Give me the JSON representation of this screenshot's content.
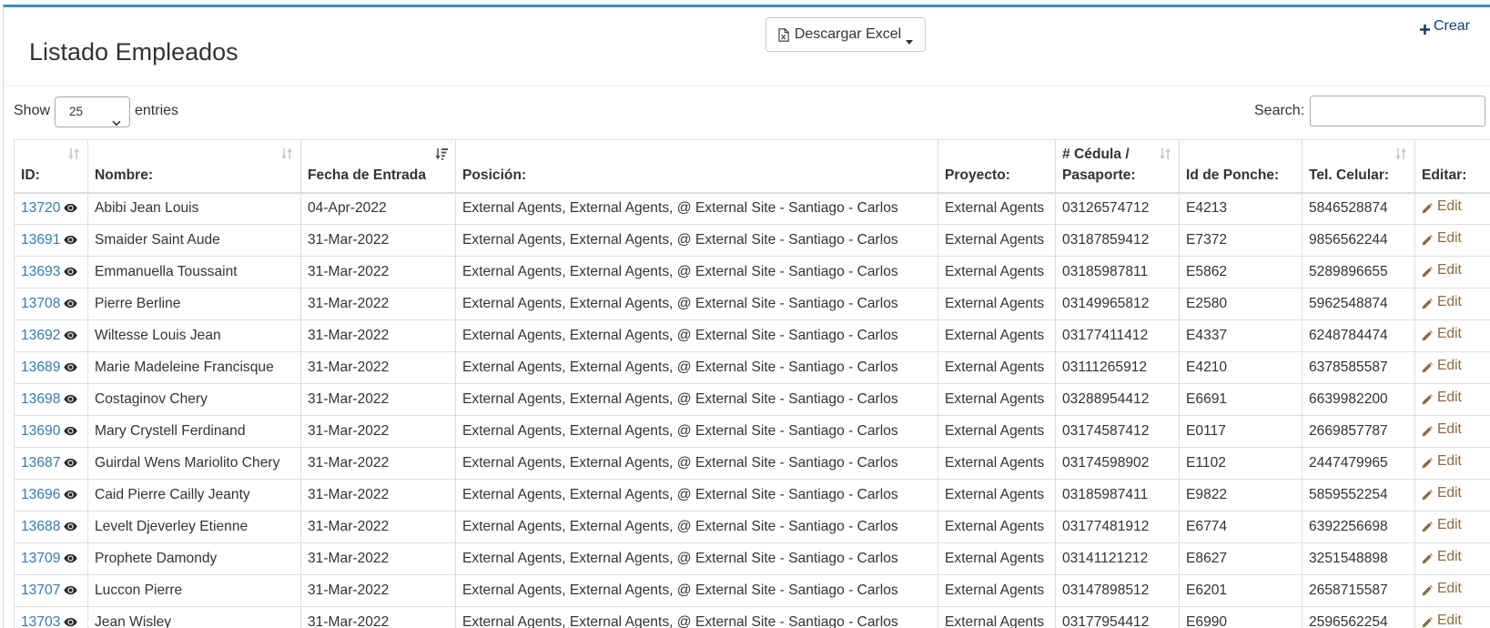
{
  "app": {
    "title": "Listado Empleados"
  },
  "toolbar": {
    "excel_label": "Descargar Excel",
    "create_label": "Crear"
  },
  "controls": {
    "show_label": "Show",
    "entries_value": "25",
    "entries_label": "entries",
    "search_label": "Search:",
    "search_value": ""
  },
  "table": {
    "columns": [
      {
        "label": "ID:",
        "sort": "both"
      },
      {
        "label": "Nombre:",
        "sort": "both"
      },
      {
        "label": "Fecha de Entrada",
        "sort": "desc"
      },
      {
        "label": "Posición:",
        "sort": "none"
      },
      {
        "label": "Proyecto:",
        "sort": "none"
      },
      {
        "label": "# Cédula / Pasaporte:",
        "sort": "both"
      },
      {
        "label": "Id de Ponche:",
        "sort": "none"
      },
      {
        "label": "Tel. Celular:",
        "sort": "both"
      },
      {
        "label": "Editar:",
        "sort": "none"
      }
    ],
    "edit_label": "Edit",
    "rows": [
      {
        "id": "13720",
        "nombre": "Abibi Jean Louis",
        "fecha": "04-Apr-2022",
        "posicion": "External Agents, External Agents, @ External Site - Santiago - Carlos",
        "proyecto": "External Agents",
        "cedula": "03126574712",
        "ponche": "E4213",
        "tel": "5846528874"
      },
      {
        "id": "13691",
        "nombre": "Smaider Saint Aude",
        "fecha": "31-Mar-2022",
        "posicion": "External Agents, External Agents, @ External Site - Santiago - Carlos",
        "proyecto": "External Agents",
        "cedula": "03187859412",
        "ponche": "E7372",
        "tel": "9856562244"
      },
      {
        "id": "13693",
        "nombre": "Emmanuella Toussaint",
        "fecha": "31-Mar-2022",
        "posicion": "External Agents, External Agents, @ External Site - Santiago - Carlos",
        "proyecto": "External Agents",
        "cedula": "03185987811",
        "ponche": "E5862",
        "tel": "5289896655"
      },
      {
        "id": "13708",
        "nombre": "Pierre Berline",
        "fecha": "31-Mar-2022",
        "posicion": "External Agents, External Agents, @ External Site - Santiago - Carlos",
        "proyecto": "External Agents",
        "cedula": "03149965812",
        "ponche": "E2580",
        "tel": "5962548874"
      },
      {
        "id": "13692",
        "nombre": "Wiltesse Louis Jean",
        "fecha": "31-Mar-2022",
        "posicion": "External Agents, External Agents, @ External Site - Santiago - Carlos",
        "proyecto": "External Agents",
        "cedula": "03177411412",
        "ponche": "E4337",
        "tel": "6248784474"
      },
      {
        "id": "13689",
        "nombre": "Marie Madeleine Francisque",
        "fecha": "31-Mar-2022",
        "posicion": "External Agents, External Agents, @ External Site - Santiago - Carlos",
        "proyecto": "External Agents",
        "cedula": "03111265912",
        "ponche": "E4210",
        "tel": "6378585587"
      },
      {
        "id": "13698",
        "nombre": "Costaginov Chery",
        "fecha": "31-Mar-2022",
        "posicion": "External Agents, External Agents, @ External Site - Santiago - Carlos",
        "proyecto": "External Agents",
        "cedula": "03288954412",
        "ponche": "E6691",
        "tel": "6639982200"
      },
      {
        "id": "13690",
        "nombre": "Mary Crystell Ferdinand",
        "fecha": "31-Mar-2022",
        "posicion": "External Agents, External Agents, @ External Site - Santiago - Carlos",
        "proyecto": "External Agents",
        "cedula": "03174587412",
        "ponche": "E0117",
        "tel": "2669857787"
      },
      {
        "id": "13687",
        "nombre": "Guirdal Wens Mariolito Chery",
        "fecha": "31-Mar-2022",
        "posicion": "External Agents, External Agents, @ External Site - Santiago - Carlos",
        "proyecto": "External Agents",
        "cedula": "03174598902",
        "ponche": "E1102",
        "tel": "2447479965"
      },
      {
        "id": "13696",
        "nombre": "Caid Pierre Cailly Jeanty",
        "fecha": "31-Mar-2022",
        "posicion": "External Agents, External Agents, @ External Site - Santiago - Carlos",
        "proyecto": "External Agents",
        "cedula": "03185987411",
        "ponche": "E9822",
        "tel": "5859552254"
      },
      {
        "id": "13688",
        "nombre": "Levelt Djeverley Etienne",
        "fecha": "31-Mar-2022",
        "posicion": "External Agents, External Agents, @ External Site - Santiago - Carlos",
        "proyecto": "External Agents",
        "cedula": "03177481912",
        "ponche": "E6774",
        "tel": "6392256698"
      },
      {
        "id": "13709",
        "nombre": "Prophete Damondy",
        "fecha": "31-Mar-2022",
        "posicion": "External Agents, External Agents, @ External Site - Santiago - Carlos",
        "proyecto": "External Agents",
        "cedula": "03141121212",
        "ponche": "E8627",
        "tel": "3251548898"
      },
      {
        "id": "13707",
        "nombre": "Luccon Pierre",
        "fecha": "31-Mar-2022",
        "posicion": "External Agents, External Agents, @ External Site - Santiago - Carlos",
        "proyecto": "External Agents",
        "cedula": "03147898512",
        "ponche": "E6201",
        "tel": "2658715587"
      },
      {
        "id": "13703",
        "nombre": "Jean Wisley",
        "fecha": "31-Mar-2022",
        "posicion": "External Agents, External Agents, @ External Site - Santiago - Carlos",
        "proyecto": "External Agents",
        "cedula": "03177954412",
        "ponche": "E6990",
        "tel": "2596562254"
      }
    ]
  },
  "colors": {
    "accent": "#3c8dbc",
    "link": "#337ab7",
    "edit": "#8a6d3b",
    "navy": "#1c3d6e"
  },
  "icons": {
    "excel": "file-excel-icon",
    "dropdown": "caret-down-icon",
    "create": "plus-icon",
    "view": "eye-icon",
    "edit": "pencil-icon",
    "sort": "sort-icon",
    "sort_active": "sort-desc-icon"
  }
}
